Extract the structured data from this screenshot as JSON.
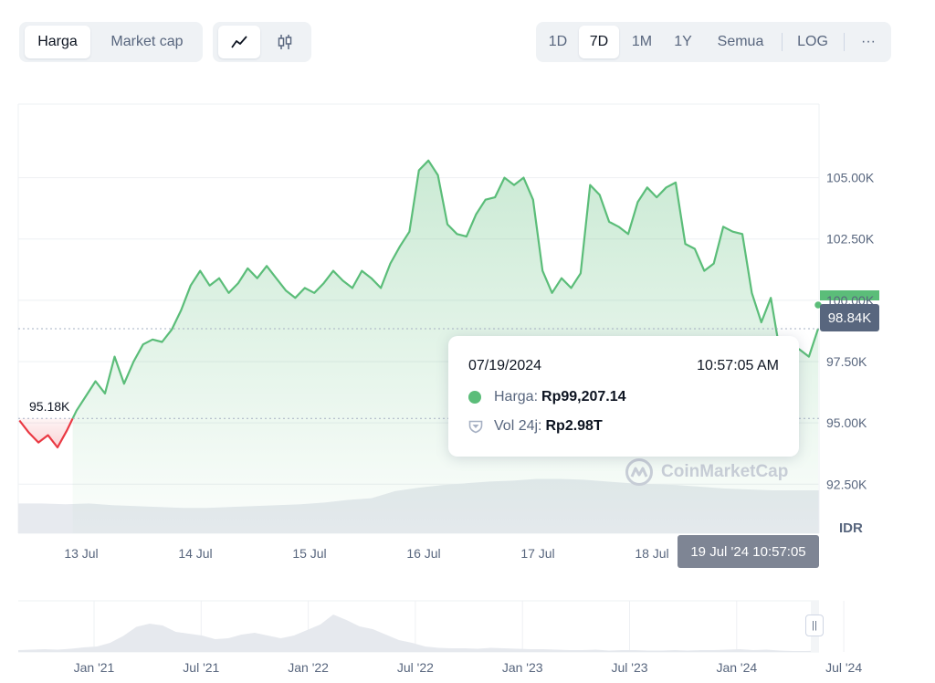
{
  "toolbar": {
    "metric_tabs": [
      {
        "label": "Harga",
        "active": true
      },
      {
        "label": "Market cap",
        "active": false
      }
    ],
    "chart_type_icons": [
      {
        "icon": "line-chart-icon",
        "active": true
      },
      {
        "icon": "candlestick-icon",
        "active": false
      }
    ],
    "range_tabs": [
      {
        "label": "1D",
        "active": false
      },
      {
        "label": "7D",
        "active": true
      },
      {
        "label": "1M",
        "active": false
      },
      {
        "label": "1Y",
        "active": false
      },
      {
        "label": "Semua",
        "active": false
      }
    ],
    "log_label": "LOG",
    "more_label": "···"
  },
  "tooltip": {
    "date": "07/19/2024",
    "time": "10:57:05 AM",
    "price_label": "Harga:",
    "price_value": "Rp99,207.14",
    "volume_label": "Vol 24j:",
    "volume_value": "Rp2.98T"
  },
  "current_price_label": "98.84K",
  "start_price_label": "95.18K",
  "hover_date_label": "19 Jul '24 10:57:05",
  "currency_label": "IDR",
  "watermark": "CoinMarketCap",
  "colors": {
    "up": "#5bbd79",
    "down": "#ea3943",
    "text_secondary": "#58667e",
    "badge": "#58667e"
  },
  "chart_data": {
    "type": "area",
    "y_unit": "IDR",
    "ylim": [
      90500,
      108000
    ],
    "y_ticks": [
      92500,
      95000,
      97500,
      100000,
      102500,
      105000
    ],
    "y_tick_labels": [
      "92.50K",
      "95.00K",
      "97.50K",
      "100.00K",
      "102.50K",
      "105.00K"
    ],
    "x_tick_labels": [
      "13 Jul",
      "14 Jul",
      "15 Jul",
      "16 Jul",
      "17 Jul",
      "18 Jul"
    ],
    "baseline_price": 95180,
    "current_price": 98840,
    "series": [
      {
        "points": [
          [
            "12 Jul 11:00",
            95100
          ],
          [
            "12 Jul 13:00",
            94600
          ],
          [
            "12 Jul 15:00",
            94200
          ],
          [
            "12 Jul 17:00",
            94500
          ],
          [
            "12 Jul 19:00",
            94000
          ],
          [
            "12 Jul 21:00",
            94700
          ],
          [
            "12 Jul 23:00",
            95500
          ],
          [
            "13 Jul 01:00",
            96100
          ],
          [
            "13 Jul 03:00",
            96700
          ],
          [
            "13 Jul 05:00",
            96200
          ],
          [
            "13 Jul 07:00",
            97700
          ],
          [
            "13 Jul 09:00",
            96600
          ],
          [
            "13 Jul 11:00",
            97500
          ],
          [
            "13 Jul 13:00",
            98200
          ],
          [
            "13 Jul 15:00",
            98400
          ],
          [
            "13 Jul 17:00",
            98300
          ],
          [
            "13 Jul 19:00",
            98800
          ],
          [
            "13 Jul 21:00",
            99600
          ],
          [
            "13 Jul 23:00",
            100600
          ],
          [
            "14 Jul 01:00",
            101200
          ],
          [
            "14 Jul 03:00",
            100600
          ],
          [
            "14 Jul 05:00",
            100900
          ],
          [
            "14 Jul 07:00",
            100300
          ],
          [
            "14 Jul 09:00",
            100700
          ],
          [
            "14 Jul 11:00",
            101300
          ],
          [
            "14 Jul 13:00",
            100900
          ],
          [
            "14 Jul 15:00",
            101400
          ],
          [
            "14 Jul 17:00",
            100900
          ],
          [
            "14 Jul 19:00",
            100400
          ],
          [
            "14 Jul 21:00",
            100100
          ],
          [
            "14 Jul 23:00",
            100500
          ],
          [
            "15 Jul 01:00",
            100300
          ],
          [
            "15 Jul 03:00",
            100700
          ],
          [
            "15 Jul 05:00",
            101200
          ],
          [
            "15 Jul 07:00",
            100800
          ],
          [
            "15 Jul 09:00",
            100500
          ],
          [
            "15 Jul 11:00",
            101200
          ],
          [
            "15 Jul 13:00",
            100900
          ],
          [
            "15 Jul 15:00",
            100500
          ],
          [
            "15 Jul 17:00",
            101500
          ],
          [
            "15 Jul 19:00",
            102200
          ],
          [
            "15 Jul 21:00",
            102800
          ],
          [
            "15 Jul 23:00",
            105300
          ],
          [
            "16 Jul 01:00",
            105700
          ],
          [
            "16 Jul 03:00",
            105100
          ],
          [
            "16 Jul 05:00",
            103100
          ],
          [
            "16 Jul 07:00",
            102700
          ],
          [
            "16 Jul 09:00",
            102600
          ],
          [
            "16 Jul 11:00",
            103500
          ],
          [
            "16 Jul 13:00",
            104100
          ],
          [
            "16 Jul 15:00",
            104200
          ],
          [
            "16 Jul 17:00",
            105000
          ],
          [
            "16 Jul 19:00",
            104700
          ],
          [
            "16 Jul 21:00",
            105000
          ],
          [
            "16 Jul 23:00",
            104100
          ],
          [
            "17 Jul 01:00",
            101200
          ],
          [
            "17 Jul 03:00",
            100300
          ],
          [
            "17 Jul 05:00",
            100900
          ],
          [
            "17 Jul 07:00",
            100500
          ],
          [
            "17 Jul 09:00",
            101100
          ],
          [
            "17 Jul 11:00",
            104700
          ],
          [
            "17 Jul 13:00",
            104300
          ],
          [
            "17 Jul 15:00",
            103200
          ],
          [
            "17 Jul 17:00",
            103000
          ],
          [
            "17 Jul 19:00",
            102700
          ],
          [
            "17 Jul 21:00",
            104000
          ],
          [
            "17 Jul 23:00",
            104600
          ],
          [
            "18 Jul 01:00",
            104200
          ],
          [
            "18 Jul 03:00",
            104600
          ],
          [
            "18 Jul 05:00",
            104800
          ],
          [
            "18 Jul 07:00",
            102300
          ],
          [
            "18 Jul 09:00",
            102100
          ],
          [
            "18 Jul 11:00",
            101200
          ],
          [
            "18 Jul 13:00",
            101500
          ],
          [
            "18 Jul 15:00",
            103000
          ],
          [
            "18 Jul 17:00",
            102800
          ],
          [
            "18 Jul 19:00",
            102700
          ],
          [
            "18 Jul 21:00",
            100300
          ],
          [
            "18 Jul 23:00",
            99100
          ],
          [
            "19 Jul 01:00",
            100100
          ],
          [
            "19 Jul 03:00",
            97800
          ],
          [
            "19 Jul 05:00",
            98100
          ],
          [
            "19 Jul 07:00",
            98000
          ],
          [
            "19 Jul 09:00",
            97700
          ],
          [
            "19 Jul 10:57",
            98840
          ]
        ]
      }
    ],
    "volume_panel": {
      "values": [
        0.34,
        0.34,
        0.33,
        0.34,
        0.32,
        0.31,
        0.3,
        0.29,
        0.29,
        0.3,
        0.31,
        0.32,
        0.33,
        0.35,
        0.38,
        0.4,
        0.48,
        0.52,
        0.55,
        0.57,
        0.59,
        0.6,
        0.62,
        0.62,
        0.61,
        0.59,
        0.57,
        0.56,
        0.55,
        0.53,
        0.51,
        0.5,
        0.49,
        0.49,
        0.49
      ]
    },
    "navigator": {
      "x_tick_labels": [
        "Jan '21",
        "Jul '21",
        "Jan '22",
        "Jul '22",
        "Jan '23",
        "Jul '23",
        "Jan '24",
        "Jul '24"
      ],
      "values": [
        0.04,
        0.05,
        0.06,
        0.05,
        0.07,
        0.1,
        0.12,
        0.2,
        0.35,
        0.55,
        0.62,
        0.58,
        0.44,
        0.4,
        0.36,
        0.28,
        0.3,
        0.38,
        0.42,
        0.36,
        0.3,
        0.36,
        0.48,
        0.6,
        0.82,
        0.7,
        0.56,
        0.5,
        0.38,
        0.26,
        0.2,
        0.12,
        0.09,
        0.08,
        0.08,
        0.07,
        0.09,
        0.08,
        0.07,
        0.06,
        0.06,
        0.05,
        0.04,
        0.04,
        0.05,
        0.03,
        0.04,
        0.04,
        0.03,
        0.03,
        0.04,
        0.03,
        0.04,
        0.04,
        0.05,
        0.06,
        0.04,
        0.05,
        0.03,
        0.02,
        0.02,
        0.03
      ]
    }
  }
}
